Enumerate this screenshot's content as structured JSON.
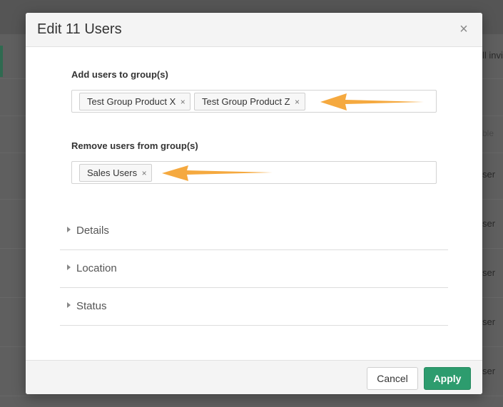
{
  "background": {
    "top_right_text": "ll invi",
    "column_header_fragment": "ble",
    "row_fragments": [
      "ser",
      "ser",
      "ser",
      "ser",
      "ser"
    ]
  },
  "dialog": {
    "title": "Edit 11 Users",
    "close_icon": "close-icon"
  },
  "add_groups": {
    "label": "Add users to group(s)",
    "tags": [
      "Test Group Product X",
      "Test Group Product Z"
    ]
  },
  "remove_groups": {
    "label": "Remove users from group(s)",
    "tags": [
      "Sales Users"
    ]
  },
  "sections": [
    "Details",
    "Location",
    "Status"
  ],
  "footer": {
    "cancel_label": "Cancel",
    "apply_label": "Apply"
  },
  "colors": {
    "accent": "#2d9c6e",
    "arrow": "#f5a93f"
  }
}
